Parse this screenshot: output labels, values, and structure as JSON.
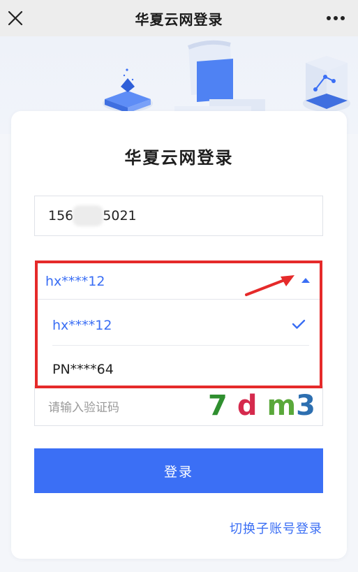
{
  "header": {
    "title": "华夏云网登录",
    "close_icon": "close-icon",
    "more_icon": "more-icon"
  },
  "card": {
    "title": "华夏云网登录"
  },
  "phone": {
    "prefix": "156",
    "suffix": "5021"
  },
  "account_select": {
    "selected": "hx****12",
    "options": [
      {
        "label": "hx****12",
        "selected": true
      },
      {
        "label": "PN****64",
        "selected": false
      }
    ]
  },
  "captcha": {
    "placeholder": "请输入验证码",
    "chars": [
      "7",
      "d",
      "m",
      "3"
    ],
    "colors": [
      "#2f8f2f",
      "#d52a4d",
      "#5aa83a",
      "#2d6fb0"
    ]
  },
  "login_button": "登录",
  "switch_link": "切换子账号登录",
  "colors": {
    "accent": "#3b6ff5",
    "highlight_border": "#e52a2a"
  }
}
